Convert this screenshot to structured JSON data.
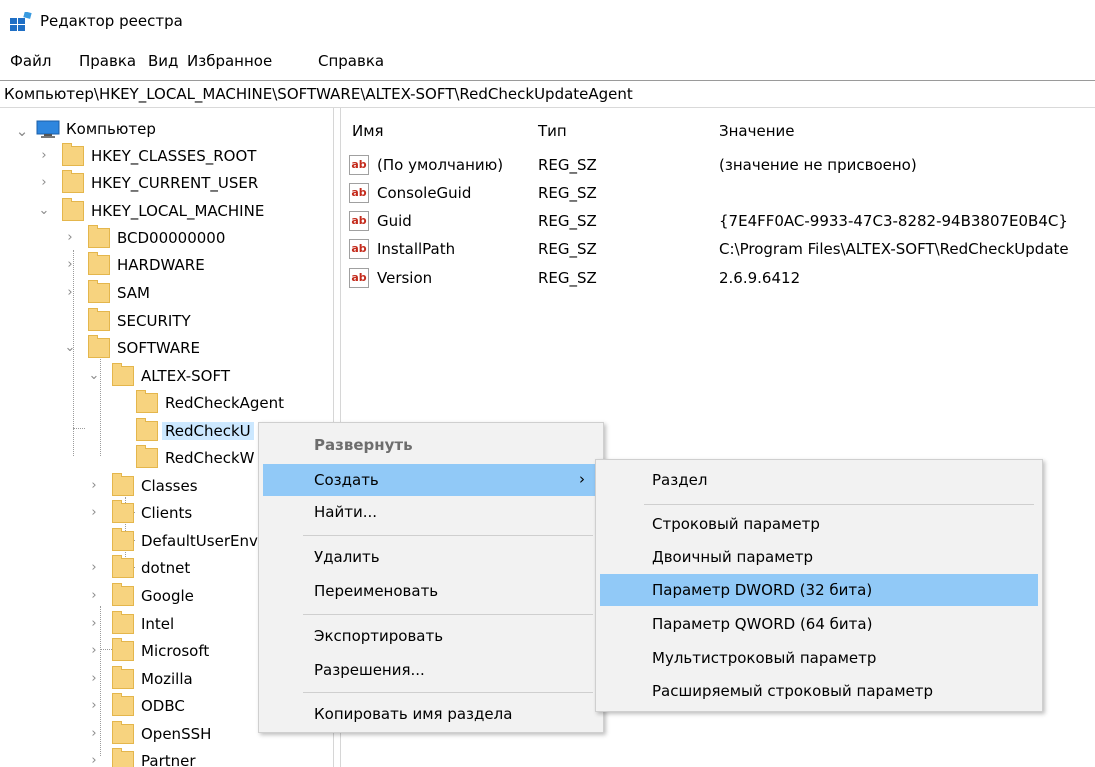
{
  "window": {
    "title": "Редактор реестра",
    "icon": "regedit-icon"
  },
  "menubar": [
    "Файл",
    "Правка",
    "Вид",
    "Избранное",
    "Справка"
  ],
  "address": "Компьютер\\HKEY_LOCAL_MACHINE\\SOFTWARE\\ALTEX-SOFT\\RedCheckUpdateAgent",
  "tree": {
    "root": "Компьютер",
    "items": [
      {
        "label": "HKEY_CLASSES_ROOT",
        "expander": "›"
      },
      {
        "label": "HKEY_CURRENT_USER",
        "expander": "›"
      },
      {
        "label": "HKEY_LOCAL_MACHINE",
        "expander": "⌄"
      },
      {
        "label": "BCD00000000",
        "expander": "›"
      },
      {
        "label": "HARDWARE",
        "expander": "›"
      },
      {
        "label": "SAM",
        "expander": "›"
      },
      {
        "label": "SECURITY",
        "expander": ""
      },
      {
        "label": "SOFTWARE",
        "expander": "⌄"
      },
      {
        "label": "ALTEX-SOFT",
        "expander": "⌄"
      },
      {
        "label": "RedCheckAgent",
        "expander": ""
      },
      {
        "label": "RedCheckU",
        "expander": "",
        "selected": true
      },
      {
        "label": "RedCheckW",
        "expander": ""
      },
      {
        "label": "Classes",
        "expander": "›"
      },
      {
        "label": "Clients",
        "expander": "›"
      },
      {
        "label": "DefaultUserEnv",
        "expander": ""
      },
      {
        "label": "dotnet",
        "expander": "›"
      },
      {
        "label": "Google",
        "expander": "›"
      },
      {
        "label": "Intel",
        "expander": "›"
      },
      {
        "label": "Microsoft",
        "expander": "›"
      },
      {
        "label": "Mozilla",
        "expander": "›"
      },
      {
        "label": "ODBC",
        "expander": "›"
      },
      {
        "label": "OpenSSH",
        "expander": "›"
      },
      {
        "label": "Partner",
        "expander": "›"
      }
    ]
  },
  "values": {
    "headers": {
      "name": "Имя",
      "type": "Тип",
      "data": "Значение"
    },
    "rows": [
      {
        "name": "(По умолчанию)",
        "type": "REG_SZ",
        "data": "(значение не присвоено)"
      },
      {
        "name": "ConsoleGuid",
        "type": "REG_SZ",
        "data": ""
      },
      {
        "name": "Guid",
        "type": "REG_SZ",
        "data": "{7E4FF0AC-9933-47C3-8282-94B3807E0B4C}"
      },
      {
        "name": "InstallPath",
        "type": "REG_SZ",
        "data": "C:\\Program Files\\ALTEX-SOFT\\RedCheckUpdate"
      },
      {
        "name": "Version",
        "type": "REG_SZ",
        "data": "2.6.9.6412"
      }
    ],
    "icon_text": "ab"
  },
  "context_menu": {
    "items": [
      {
        "label": "Развернуть"
      },
      {
        "label": "Создать",
        "submenu_arrow": "›"
      },
      {
        "label": "Найти..."
      },
      {
        "label": "Удалить"
      },
      {
        "label": "Переименовать"
      },
      {
        "label": "Экспортировать"
      },
      {
        "label": "Разрешения..."
      },
      {
        "label": "Копировать имя раздела"
      }
    ]
  },
  "submenu": {
    "items": [
      {
        "label": "Раздел"
      },
      {
        "label": "Строковый параметр"
      },
      {
        "label": "Двоичный параметр"
      },
      {
        "label": "Параметр DWORD (32 бита)"
      },
      {
        "label": "Параметр QWORD (64 бита)"
      },
      {
        "label": "Мультистроковый параметр"
      },
      {
        "label": "Расширяемый строковый параметр"
      }
    ]
  },
  "colors": {
    "highlight": "#91c9f7",
    "selection": "#cce8ff",
    "folder": "#f7d37f"
  }
}
